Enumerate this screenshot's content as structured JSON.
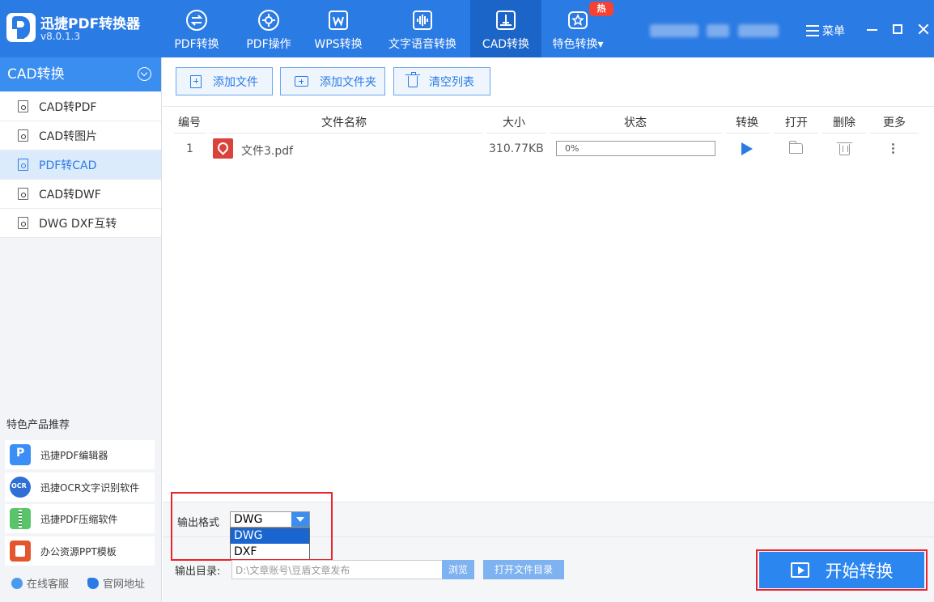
{
  "app": {
    "title": "迅捷PDF转换器",
    "version": "v8.0.1.3"
  },
  "nav": {
    "tabs": [
      {
        "label": "PDF转换",
        "icon": "convert-icon"
      },
      {
        "label": "PDF操作",
        "icon": "gear-icon"
      },
      {
        "label": "WPS转换",
        "icon": "wps-icon"
      },
      {
        "label": "文字语音转换",
        "icon": "audio-wave-icon"
      },
      {
        "label": "CAD转换",
        "icon": "cad-icon",
        "active": true
      },
      {
        "label": "特色转换",
        "icon": "star-icon",
        "badge": "热"
      }
    ],
    "menu_label": "菜单"
  },
  "sidebar": {
    "header": "CAD转换",
    "items": [
      {
        "label": "CAD转PDF"
      },
      {
        "label": "CAD转图片"
      },
      {
        "label": "PDF转CAD",
        "active": true
      },
      {
        "label": "CAD转DWF"
      },
      {
        "label": "DWG DXF互转"
      }
    ],
    "promo_title": "特色产品推荐",
    "promos": [
      {
        "label": "迅捷PDF编辑器",
        "icon": "pdf-editor-icon"
      },
      {
        "label": "迅捷OCR文字识别软件",
        "icon": "ocr-icon"
      },
      {
        "label": "迅捷PDF压缩软件",
        "icon": "zip-icon"
      },
      {
        "label": "办公资源PPT模板",
        "icon": "ppt-icon"
      }
    ],
    "footer": {
      "service": "在线客服",
      "website": "官网地址"
    }
  },
  "toolbar": {
    "add_file": "添加文件",
    "add_folder": "添加文件夹",
    "clear_list": "清空列表"
  },
  "table": {
    "headers": {
      "index": "编号",
      "name": "文件名称",
      "size": "大小",
      "status": "状态",
      "convert": "转换",
      "open": "打开",
      "delete": "删除",
      "more": "更多"
    },
    "rows": [
      {
        "index": "1",
        "name": "文件3.pdf",
        "size": "310.77KB",
        "progress": 0,
        "progress_text": "0%"
      }
    ]
  },
  "output": {
    "format_label": "输出格式",
    "format_value": "DWG",
    "format_options": [
      "DWG",
      "DXF"
    ],
    "dir_label": "输出目录:",
    "dir_value": "D:\\文章账号\\豆盾文章发布",
    "browse": "浏览",
    "open_dir": "打开文件目录",
    "start": "开始转换"
  },
  "colors": {
    "primary": "#2b7be4",
    "active_tab": "#1b64c8",
    "highlight": "#e8242d",
    "badge": "#f44336"
  }
}
